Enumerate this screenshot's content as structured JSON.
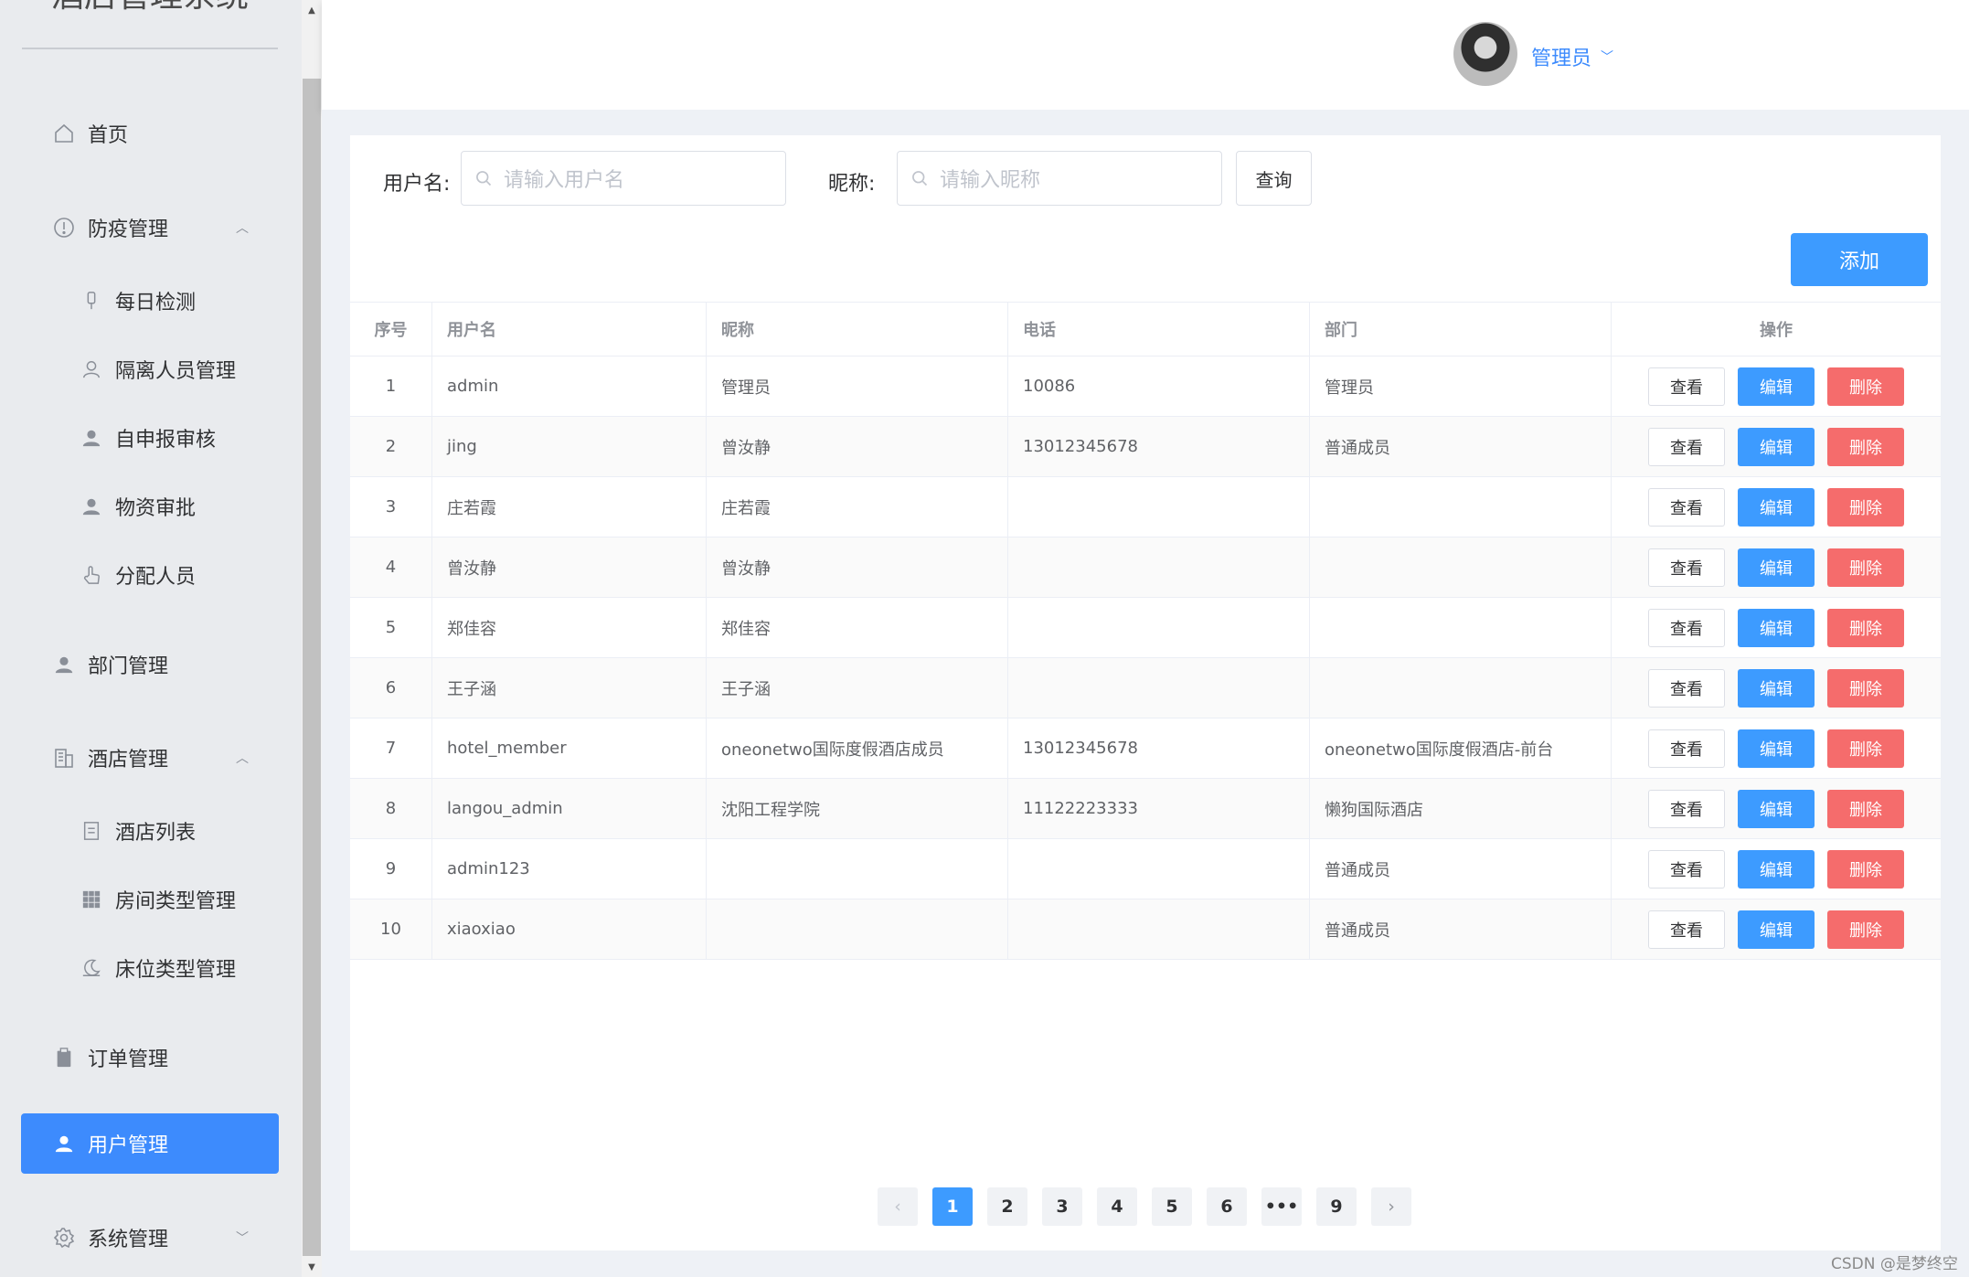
{
  "app": {
    "title": "酒店管理系统"
  },
  "sidebar": {
    "items": [
      {
        "label": "首页",
        "icon": "home-icon"
      },
      {
        "label": "防疫管理",
        "icon": "warning-circle-icon",
        "expanded": true
      },
      {
        "label": "每日检测",
        "icon": "thermometer-icon"
      },
      {
        "label": "隔离人员管理",
        "icon": "user-outline-icon"
      },
      {
        "label": "自申报审核",
        "icon": "user-solid-icon"
      },
      {
        "label": "物资审批",
        "icon": "user-solid-icon"
      },
      {
        "label": "分配人员",
        "icon": "pointer-hand-icon"
      },
      {
        "label": "部门管理",
        "icon": "user-solid-icon"
      },
      {
        "label": "酒店管理",
        "icon": "office-building-icon",
        "expanded": true
      },
      {
        "label": "酒店列表",
        "icon": "document-icon"
      },
      {
        "label": "房间类型管理",
        "icon": "grid-icon"
      },
      {
        "label": "床位类型管理",
        "icon": "moon-icon"
      },
      {
        "label": "订单管理",
        "icon": "clipboard-icon"
      },
      {
        "label": "用户管理",
        "icon": "user-solid-icon",
        "active": true
      },
      {
        "label": "系统管理",
        "icon": "gear-icon",
        "expanded": false
      }
    ]
  },
  "header": {
    "user_name": "管理员"
  },
  "search": {
    "username_label": "用户名:",
    "username_placeholder": "请输入用户名",
    "nickname_label": "昵称:",
    "nickname_placeholder": "请输入昵称",
    "query_label": "查询",
    "add_label": "添加"
  },
  "table": {
    "columns": [
      "序号",
      "用户名",
      "昵称",
      "电话",
      "部门",
      "操作"
    ],
    "action_labels": {
      "view": "查看",
      "edit": "编辑",
      "delete": "删除"
    },
    "rows": [
      {
        "no": "1",
        "username": "admin",
        "nickname": "管理员",
        "phone": "10086",
        "dept": "管理员"
      },
      {
        "no": "2",
        "username": "jing",
        "nickname": "曾汝静",
        "phone": "13012345678",
        "dept": "普通成员"
      },
      {
        "no": "3",
        "username": "庄若霞",
        "nickname": "庄若霞",
        "phone": "",
        "dept": ""
      },
      {
        "no": "4",
        "username": "曾汝静",
        "nickname": "曾汝静",
        "phone": "",
        "dept": ""
      },
      {
        "no": "5",
        "username": "郑佳容",
        "nickname": "郑佳容",
        "phone": "",
        "dept": ""
      },
      {
        "no": "6",
        "username": "王子涵",
        "nickname": "王子涵",
        "phone": "",
        "dept": ""
      },
      {
        "no": "7",
        "username": "hotel_member",
        "nickname": "oneonetwo国际度假酒店成员",
        "phone": "13012345678",
        "dept": "oneonetwo国际度假酒店-前台"
      },
      {
        "no": "8",
        "username": "langou_admin",
        "nickname": "沈阳工程学院",
        "phone": "11122223333",
        "dept": "懒狗国际酒店"
      },
      {
        "no": "9",
        "username": "admin123",
        "nickname": "",
        "phone": "",
        "dept": "普通成员"
      },
      {
        "no": "10",
        "username": "xiaoxiao",
        "nickname": "",
        "phone": "",
        "dept": "普通成员"
      }
    ]
  },
  "pagination": {
    "prev": "‹",
    "pages": [
      "1",
      "2",
      "3",
      "4",
      "5",
      "6",
      "•••",
      "9"
    ],
    "current": "1",
    "next": "›"
  },
  "watermark": "CSDN @是梦终空",
  "colors": {
    "primary": "#3d9bff",
    "danger": "#f56c6c",
    "active_menu": "#3d8bfd",
    "sidebar_bg": "#e9ebee"
  }
}
